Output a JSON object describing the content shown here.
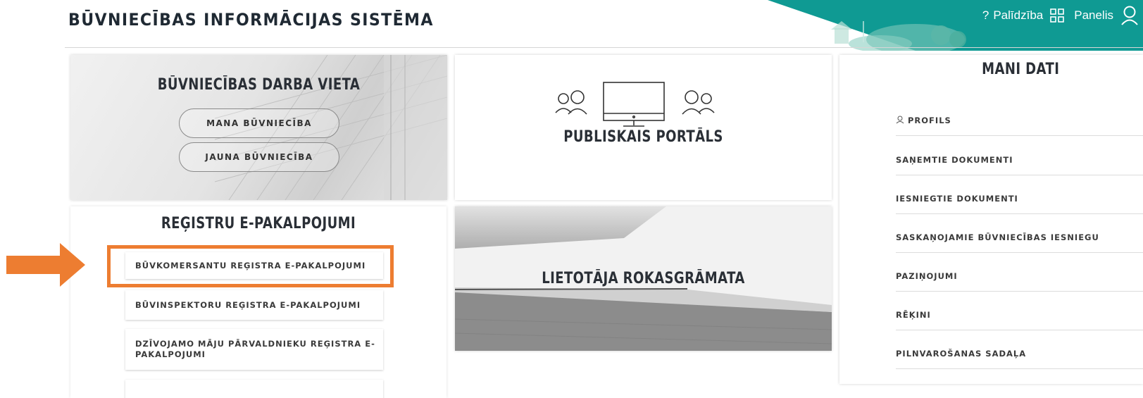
{
  "header": {
    "title": "BŪVNIECĪBAS INFORMĀCIJAS SISTĒMA",
    "help_label": "Palīdzība",
    "panel_label": "Panelis",
    "accent_color": "#0f9a93"
  },
  "workplace": {
    "title": "BŪVNIECĪBAS DARBA VIETA",
    "my_construction": "MANA BŪVNIECĪBA",
    "new_construction": "JAUNA BŪVNIECĪBA"
  },
  "portal": {
    "title": "PUBLISKAIS PORTĀLS"
  },
  "registry": {
    "title": "REĢISTRU E-PAKALPOJUMI",
    "items": [
      "BŪVKOMERSANTU REĢISTRA E-PAKALPOJUMI",
      "BŪVINSPEKTORU REĢISTRA E-PAKALPOJUMI",
      "DZĪVOJAMO MĀJU PĀRVALDNIEKU REĢISTRA E-PAKALPOJUMI"
    ]
  },
  "manual": {
    "title": "LIETOTĀJA ROKASGRĀMATA"
  },
  "my_data": {
    "title": "MANI DATI",
    "items": [
      "PROFILS",
      "SAŅEMTIE DOKUMENTI",
      "IESNIEGTIE DOKUMENTI",
      "SASKAŅOJAMIE BŪVNIECĪBAS IESNIEGU",
      "PAZIŅOJUMI",
      "RĒĶINI",
      "PILNVAROŠANAS SADAĻA"
    ]
  },
  "annotation": {
    "highlight_color": "#ed7d31"
  }
}
